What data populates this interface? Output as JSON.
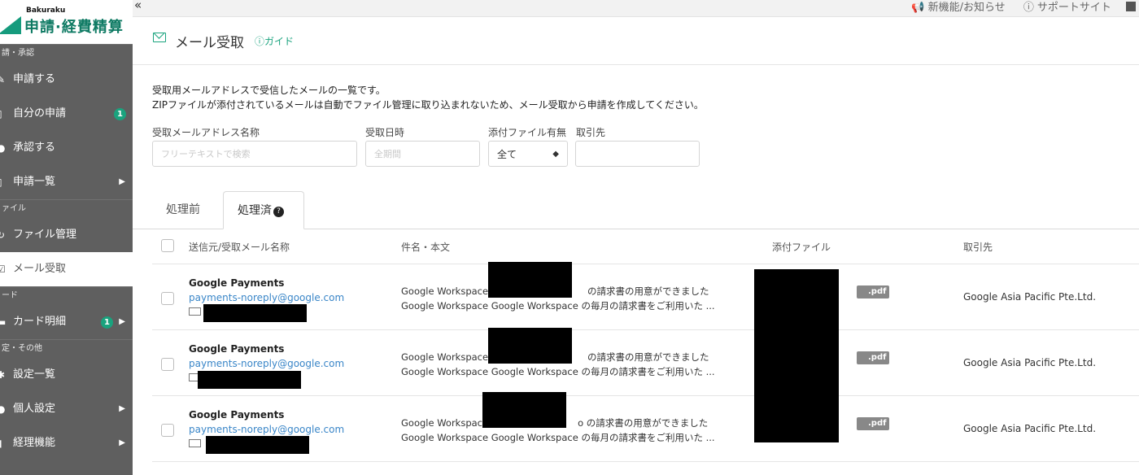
{
  "brand": {
    "small": "Bakuraku",
    "name": "申請·経費精算"
  },
  "sidebar": {
    "sections": [
      {
        "label": "請・承認",
        "items": [
          {
            "label": "申請する",
            "icon": "edit-icon"
          },
          {
            "label": "自分の申請",
            "icon": "doc-icon",
            "badge": "1"
          },
          {
            "label": "承認する",
            "icon": "check-icon"
          },
          {
            "label": "申請一覧",
            "icon": "list-icon",
            "caret": "▶"
          }
        ]
      },
      {
        "label": "ァイル",
        "items": [
          {
            "label": "ファイル管理",
            "icon": "file-icon"
          },
          {
            "label": "メール受取",
            "icon": "mail-icon",
            "active": true
          }
        ]
      },
      {
        "label": "ード",
        "items": [
          {
            "label": "カード明細",
            "icon": "card-icon",
            "badge": "1",
            "caret": "▶"
          }
        ]
      },
      {
        "label": "定・その他",
        "items": [
          {
            "label": "設定一覧",
            "icon": "gear-icon"
          },
          {
            "label": "個人設定",
            "icon": "user-icon",
            "caret": "▶"
          },
          {
            "label": "経理機能",
            "icon": "book-icon",
            "caret": "▶"
          }
        ]
      }
    ]
  },
  "topbar": {
    "collapse": "«",
    "news": "新機能/お知らせ",
    "support": "サポートサイト"
  },
  "page": {
    "title": "メール受取",
    "guide": "ガイド",
    "desc_line1": "受取用メールアドレスで受信したメールの一覧です。",
    "desc_line2": "ZIPファイルが添付されているメールは自動でファイル管理に取り込まれないため、メール受取から申請を作成してください。"
  },
  "filters": {
    "address_label": "受取メールアドレス名称",
    "address_placeholder": "フリーテキストで検索",
    "date_label": "受取日時",
    "date_placeholder": "全期間",
    "attach_label": "添付ファイル有無",
    "attach_value": "全て",
    "vendor_label": "取引先",
    "vendor_value": ""
  },
  "tabs": {
    "before": "処理前",
    "after": "処理済"
  },
  "table": {
    "headers": {
      "sender": "送信元/受取メール名称",
      "subject": "件名・本文",
      "attachment": "添付ファイル",
      "vendor": "取引先"
    },
    "rows": [
      {
        "name": "Google Payments",
        "email": "payments-noreply@google.com",
        "subject_a": "Google Workspace:",
        "subject_b": "の請求書の用意ができました",
        "body": "Google Workspace Google Workspace の毎月の請求書をご利用いた ...",
        "pdf": ".pdf",
        "vendor": "Google Asia Pacific Pte.Ltd."
      },
      {
        "name": "Google Payments",
        "email": "payments-noreply@google.com",
        "subject_a": "Google Workspace:",
        "subject_b": "の請求書の用意ができました",
        "body": "Google Workspace Google Workspace の毎月の請求書をご利用いた ...",
        "pdf": ".pdf",
        "vendor": "Google Asia Pacific Pte.Ltd."
      },
      {
        "name": "Google Payments",
        "email": "payments-noreply@google.com",
        "subject_a": "Google Workspace",
        "subject_b": "o の請求書の用意ができました",
        "body": "Google Workspace Google Workspace の毎月の請求書をご利用いた ...",
        "pdf": ".pdf",
        "vendor": "Google Asia Pacific Pte.Ltd."
      }
    ]
  },
  "colors": {
    "accent": "#1aa37e",
    "sidebar": "#5f5f5f",
    "link": "#3a86c8"
  }
}
